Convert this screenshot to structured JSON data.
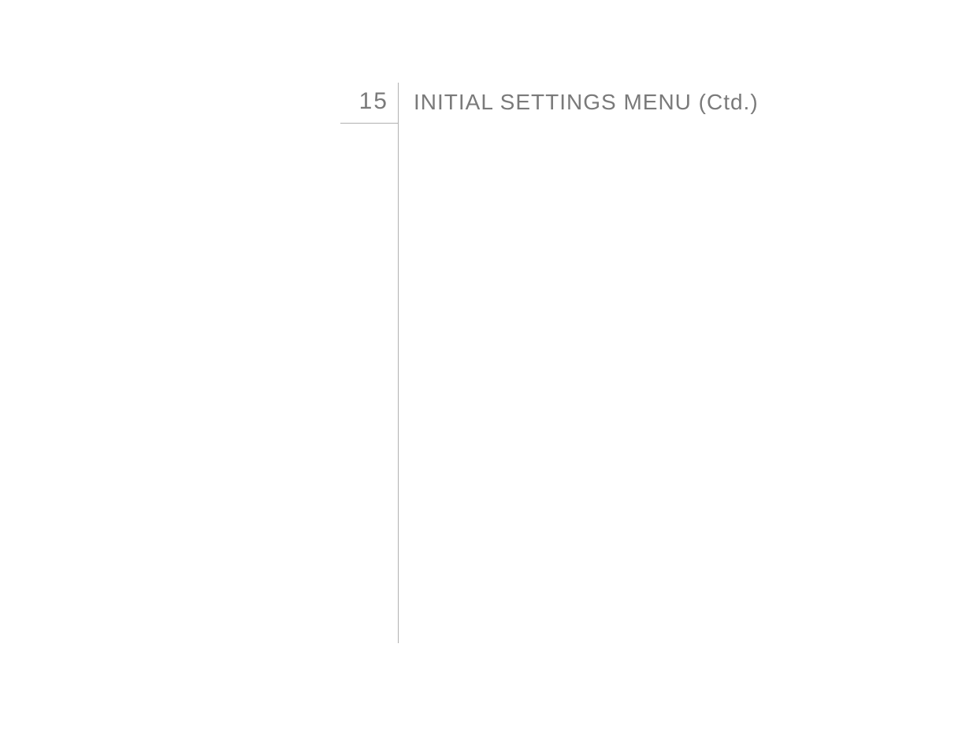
{
  "section": {
    "number": "15",
    "title": "INITIAL SETTINGS MENU (Ctd.)"
  }
}
